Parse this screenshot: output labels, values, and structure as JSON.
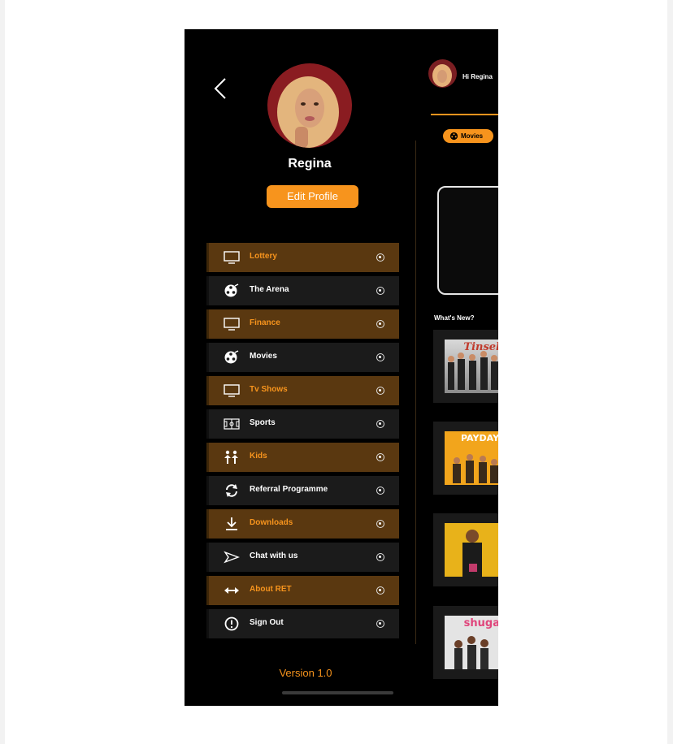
{
  "profile": {
    "name": "Regina",
    "edit_label": "Edit Profile",
    "greeting": "Hi Regina"
  },
  "menu": [
    {
      "label": "Lottery",
      "icon": "tv-icon",
      "highlighted": true
    },
    {
      "label": "The Arena",
      "icon": "film-reel-icon",
      "highlighted": false
    },
    {
      "label": "Finance",
      "icon": "tv-icon",
      "highlighted": true
    },
    {
      "label": "Movies",
      "icon": "film-reel-icon",
      "highlighted": false
    },
    {
      "label": "Tv Shows",
      "icon": "tv-icon",
      "highlighted": true
    },
    {
      "label": "Sports",
      "icon": "football-pitch-icon",
      "highlighted": false
    },
    {
      "label": "Kids",
      "icon": "kids-icon",
      "highlighted": true
    },
    {
      "label": "Referral Programme",
      "icon": "refresh-icon",
      "highlighted": false
    },
    {
      "label": "Downloads",
      "icon": "download-icon",
      "highlighted": true
    },
    {
      "label": "Chat with us",
      "icon": "send-icon",
      "highlighted": false
    },
    {
      "label": "About RET",
      "icon": "arrows-horizontal-icon",
      "highlighted": true
    },
    {
      "label": "Sign Out",
      "icon": "alert-circle-icon",
      "highlighted": false
    }
  ],
  "version": "Version 1.0",
  "background_screen": {
    "category_pill": "Movies",
    "section_title": "What's New?",
    "thumbnails": [
      {
        "title": "Tinsel"
      },
      {
        "title": "PAYDAY"
      },
      {
        "title": ""
      },
      {
        "title": "shuga"
      }
    ]
  },
  "colors": {
    "accent": "#f7941d",
    "background": "#000000",
    "menu_dark": "#1b1b1b",
    "menu_highlight": "#5a3810"
  }
}
